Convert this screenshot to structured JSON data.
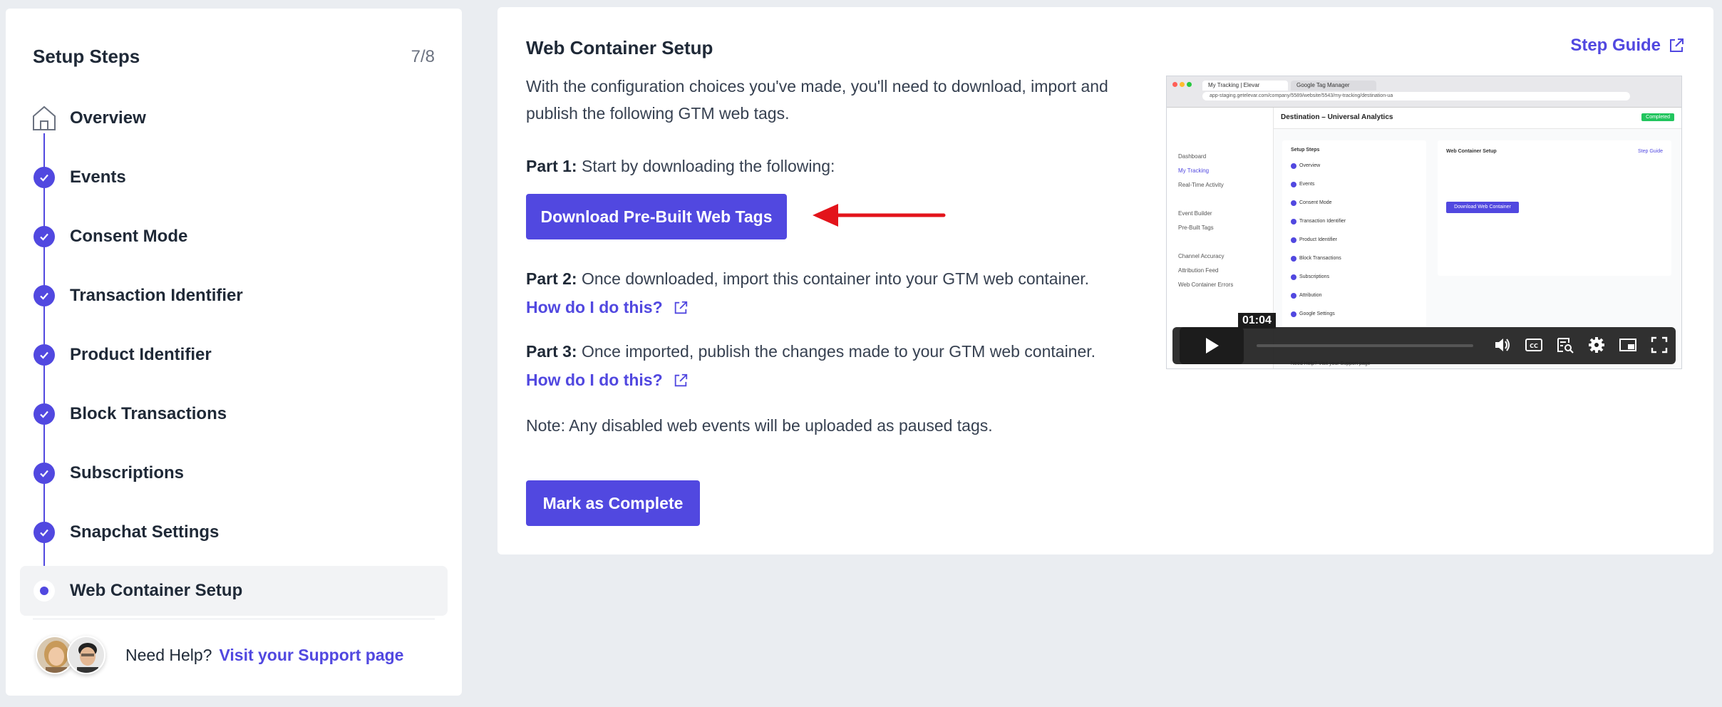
{
  "sidebar": {
    "title": "Setup Steps",
    "count": "7/8",
    "steps": [
      {
        "label": "Overview"
      },
      {
        "label": "Events"
      },
      {
        "label": "Consent Mode"
      },
      {
        "label": "Transaction Identifier"
      },
      {
        "label": "Product Identifier"
      },
      {
        "label": "Block Transactions"
      },
      {
        "label": "Subscriptions"
      },
      {
        "label": "Snapchat Settings"
      },
      {
        "label": "Web Container Setup"
      }
    ],
    "help_text": "Need Help?",
    "help_link": "Visit your Support page"
  },
  "main": {
    "title": "Web Container Setup",
    "step_guide": "Step Guide",
    "intro": "With the configuration choices you've made, you'll need to download, import and publish the following GTM web tags.",
    "part1_label": "Part 1:",
    "part1_text": "Start by downloading the following:",
    "download_button": "Download Pre-Built Web Tags",
    "part2_label": "Part 2:",
    "part2_text": "Once downloaded, import this container into your GTM web container.",
    "howto_1": "How do I do this?",
    "part3_label": "Part 3:",
    "part3_text": "Once imported, publish the changes made to your GTM web container.",
    "howto_2": "How do I do this?",
    "note": "Note: Any disabled web events will be uploaded as paused tags.",
    "complete_button": "Mark as Complete"
  },
  "video": {
    "time": "01:04",
    "tab1": "My Tracking | Elevar",
    "tab2": "Google Tag Manager",
    "url": "app-staging.getelevar.com/company/5589/website/5543/my-tracking/destination-ua",
    "header_title": "Destination – Universal Analytics",
    "completed_badge": "Completed",
    "nav_items": [
      "Dashboard",
      "My Tracking",
      "Real-Time Activity",
      "Event Builder",
      "Pre-Built Tags",
      "Channel Accuracy",
      "Attribution Feed",
      "Web Container Errors"
    ],
    "steps_title": "Setup Steps",
    "steps": [
      "Overview",
      "Events",
      "Consent Mode",
      "Transaction Identifier",
      "Product Identifier",
      "Block Transactions",
      "Subscriptions",
      "Attribution",
      "Google Settings"
    ],
    "content_title": "Web Container Setup",
    "content_guide": "Step Guide",
    "content_button": "Download Web Container",
    "footer": "Need Help? Visit your Support page"
  },
  "colors": {
    "accent": "#5148e0",
    "arrow": "#e3141b",
    "background": "#eaedf1"
  }
}
